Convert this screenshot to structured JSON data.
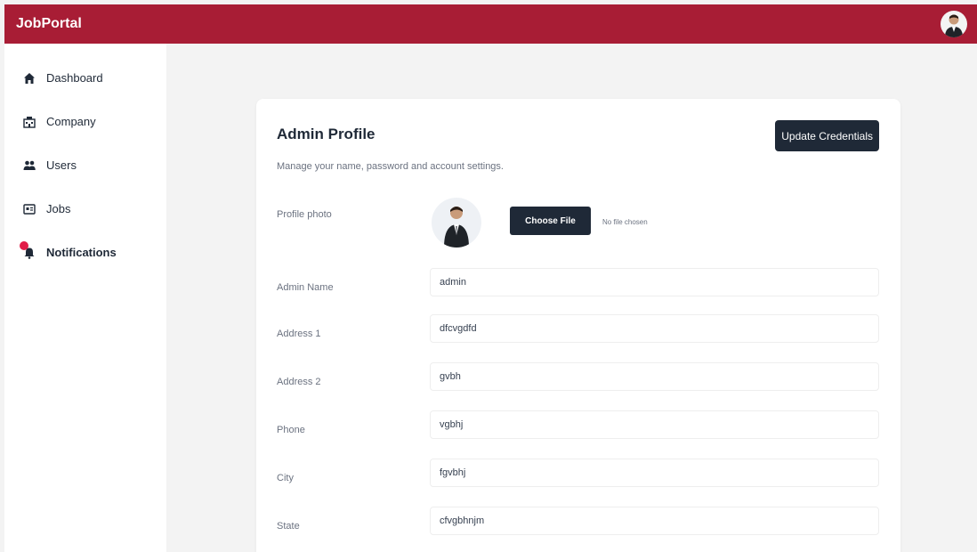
{
  "header": {
    "brand": "JobPortal"
  },
  "sidebar": {
    "items": [
      {
        "label": "Dashboard",
        "icon": "home-icon"
      },
      {
        "label": "Company",
        "icon": "building-icon"
      },
      {
        "label": "Users",
        "icon": "users-icon"
      },
      {
        "label": "Jobs",
        "icon": "jobs-icon"
      },
      {
        "label": "Notifications",
        "icon": "bell-icon"
      }
    ]
  },
  "profile": {
    "title": "Admin Profile",
    "subtitle": "Manage your name, password and account settings.",
    "update_label": "Update Credentials",
    "photo_label": "Profile photo",
    "choose_file_label": "Choose File",
    "no_file_text": "No file chosen",
    "fields": [
      {
        "label": "Admin Name",
        "value": "admin"
      },
      {
        "label": "Address 1",
        "value": "dfcvgdfd"
      },
      {
        "label": "Address 2",
        "value": "gvbh"
      },
      {
        "label": "Phone",
        "value": "vgbhj"
      },
      {
        "label": "City",
        "value": "fgvbhj"
      },
      {
        "label": "State",
        "value": "cfvgbhnjm"
      }
    ]
  },
  "colors": {
    "header": "#a81d35",
    "button": "#1f2937",
    "notification_dot": "#e11d48"
  }
}
